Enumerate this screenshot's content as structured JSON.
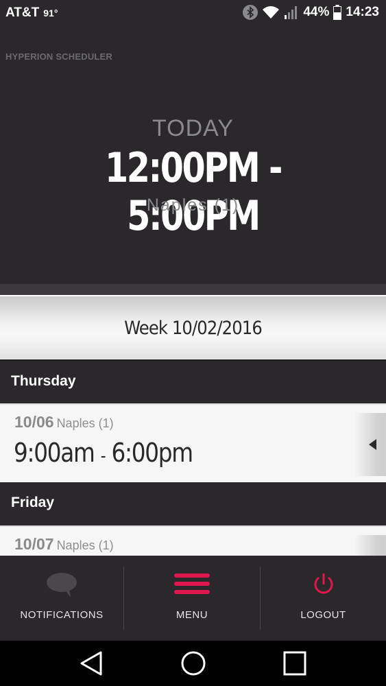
{
  "status_bar": {
    "carrier": "AT&T",
    "temperature": "91°",
    "battery_percent": "44%",
    "time": "14:23"
  },
  "app": {
    "name": "HYPERION SCHEDULER"
  },
  "today": {
    "label": "TODAY",
    "time_range": "12:00PM - 5:00PM",
    "location": "Naples (1)"
  },
  "week": {
    "title": "Week 10/02/2016"
  },
  "days": [
    {
      "day_name": "Thursday",
      "shift": {
        "date": "10/06",
        "location": "Naples (1)",
        "start": "9:00am",
        "separator": "-",
        "end": "6:00pm"
      }
    },
    {
      "day_name": "Friday",
      "shift": {
        "date": "10/07",
        "location": "Naples (1)"
      }
    }
  ],
  "bottom_nav": {
    "notifications_label": "NOTIFICATIONS",
    "menu_label": "MENU",
    "logout_label": "LOGOUT"
  },
  "colors": {
    "background": "#2a282a",
    "accent": "#e0174f",
    "card": "#f6f6f6"
  },
  "icons": {
    "notifications": "chat-bubble-icon",
    "menu": "hamburger-icon",
    "logout": "power-icon"
  }
}
